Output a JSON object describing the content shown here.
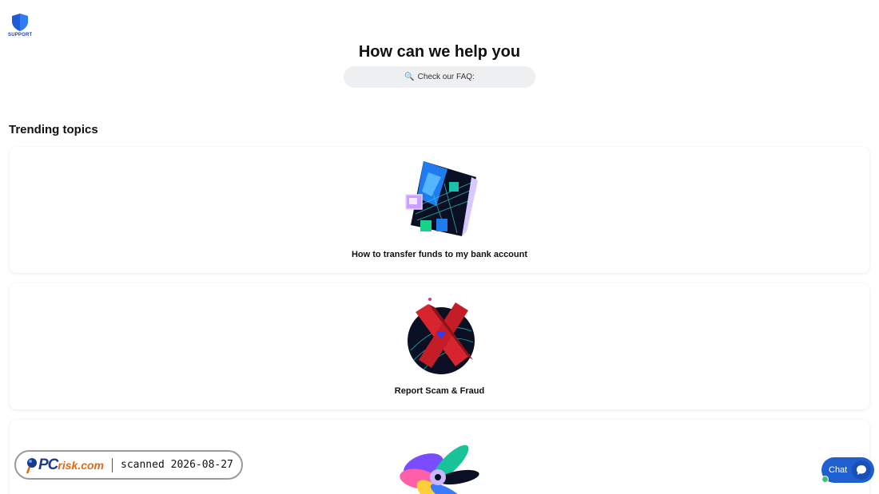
{
  "brand": {
    "logo_text": "SUPPORT",
    "accent": "#1f5fd0"
  },
  "hero": {
    "title": "How can we help you",
    "search_placeholder": "Check our FAQ:"
  },
  "trending": {
    "title": "Trending topics",
    "items": [
      {
        "label": "How to transfer funds to my bank account",
        "icon": "wallet-cards-illustration-icon"
      },
      {
        "label": "Report Scam & Fraud",
        "icon": "red-x-illustration-icon"
      },
      {
        "label": "",
        "icon": "fan-disks-illustration-icon"
      }
    ]
  },
  "watermark": {
    "logo_pc": "PC",
    "logo_risk": "risk.com",
    "text": "scanned 2026-08-27"
  },
  "chat": {
    "label": "Chat",
    "status_color": "#3ec46d"
  }
}
